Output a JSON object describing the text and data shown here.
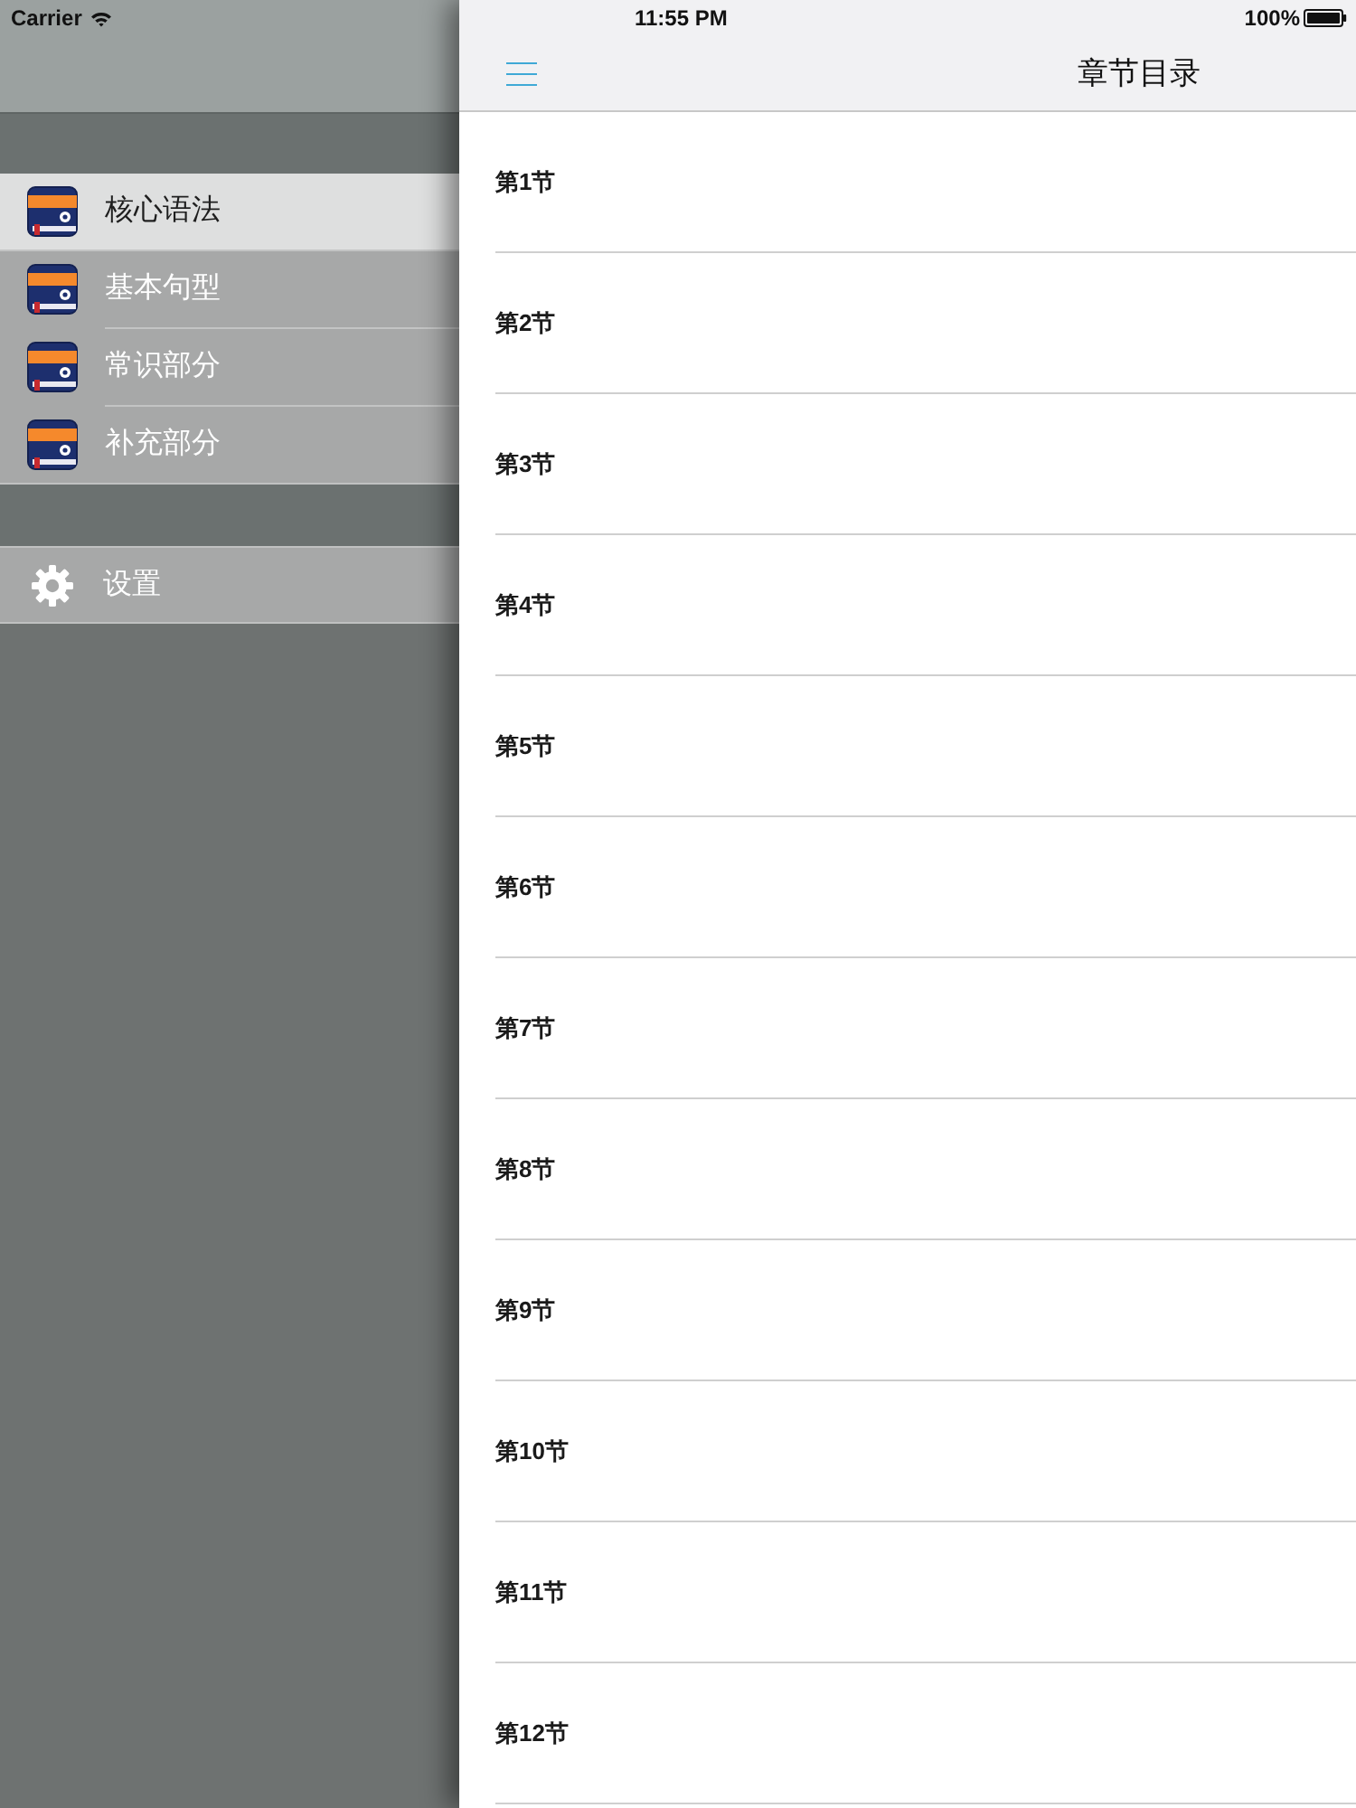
{
  "status_bar": {
    "carrier": "Carrier",
    "time": "11:55 PM",
    "battery": "100%"
  },
  "sidebar": {
    "items": [
      {
        "label": "核心语法",
        "selected": true
      },
      {
        "label": "基本句型",
        "selected": false
      },
      {
        "label": "常识部分",
        "selected": false
      },
      {
        "label": "补充部分",
        "selected": false
      }
    ],
    "settings": {
      "label": "设置"
    }
  },
  "nav_bar": {
    "title": "章节目录"
  },
  "sections": [
    "第1节",
    "第2节",
    "第3节",
    "第4节",
    "第5节",
    "第6节",
    "第7节",
    "第8节",
    "第9节",
    "第10节",
    "第11节",
    "第12节"
  ]
}
